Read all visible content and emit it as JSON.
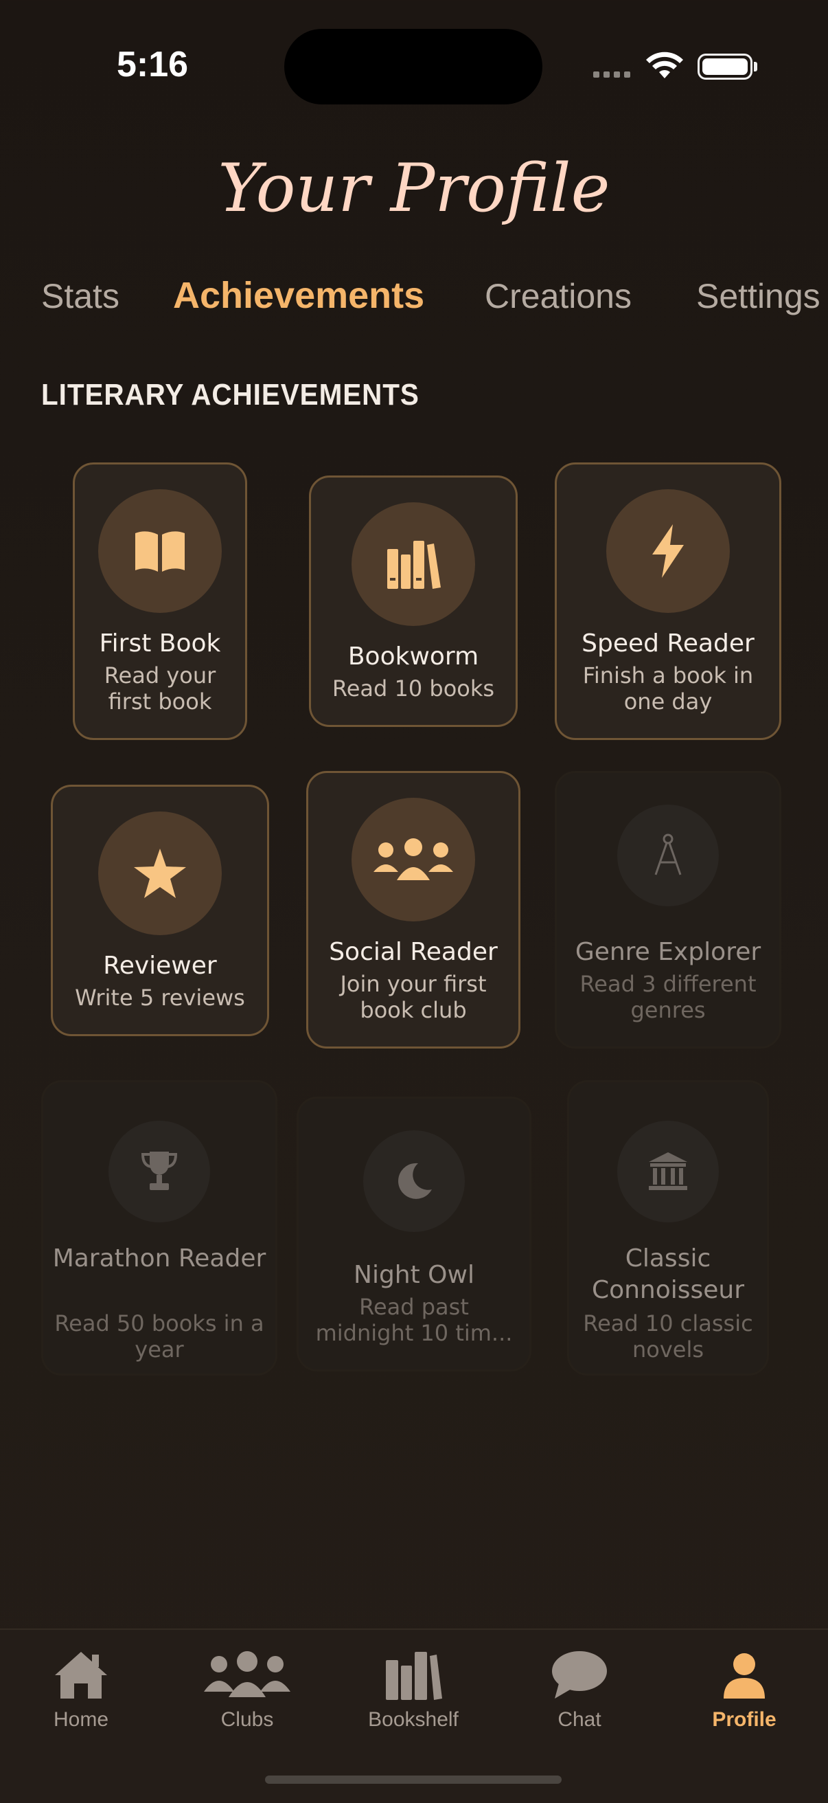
{
  "status": {
    "time": "5:16"
  },
  "page": {
    "title": "Your Profile"
  },
  "tabs": [
    "Stats",
    "Achievements",
    "Creations",
    "Settings"
  ],
  "section_title": "LITERARY ACHIEVEMENTS",
  "achievements": [
    {
      "name": "First Book",
      "desc": "Read your first book",
      "unlocked": true,
      "icon": "open-book-icon"
    },
    {
      "name": "Bookworm",
      "desc": "Read 10 books",
      "unlocked": true,
      "icon": "books-icon"
    },
    {
      "name": "Speed Reader",
      "desc": "Finish a book in one day",
      "unlocked": true,
      "icon": "lightning-icon"
    },
    {
      "name": "Reviewer",
      "desc": "Write 5 reviews",
      "unlocked": true,
      "icon": "star-icon"
    },
    {
      "name": "Social Reader",
      "desc": "Join your first book club",
      "unlocked": true,
      "icon": "people-icon"
    },
    {
      "name": "Genre Explorer",
      "desc": "Read 3 different genres",
      "unlocked": false,
      "icon": "compass-icon"
    },
    {
      "name": "Marathon Reader",
      "desc": "Read 50 books in a year",
      "unlocked": false,
      "icon": "trophy-icon"
    },
    {
      "name": "Night Owl",
      "desc": "Read past midnight 10 tim...",
      "unlocked": false,
      "icon": "moon-icon"
    },
    {
      "name": "Classic Connoisseur",
      "desc": "Read 10 classic novels",
      "unlocked": false,
      "icon": "museum-icon"
    }
  ],
  "nav": [
    {
      "label": "Home",
      "icon": "home-icon"
    },
    {
      "label": "Clubs",
      "icon": "group-icon"
    },
    {
      "label": "Bookshelf",
      "icon": "bookshelf-icon"
    },
    {
      "label": "Chat",
      "icon": "chat-bubble-icon"
    },
    {
      "label": "Profile",
      "icon": "person-icon",
      "active": true
    }
  ],
  "colors": {
    "accent": "#f5b56a",
    "title": "#ffd7c4",
    "background": "#1f1914"
  }
}
